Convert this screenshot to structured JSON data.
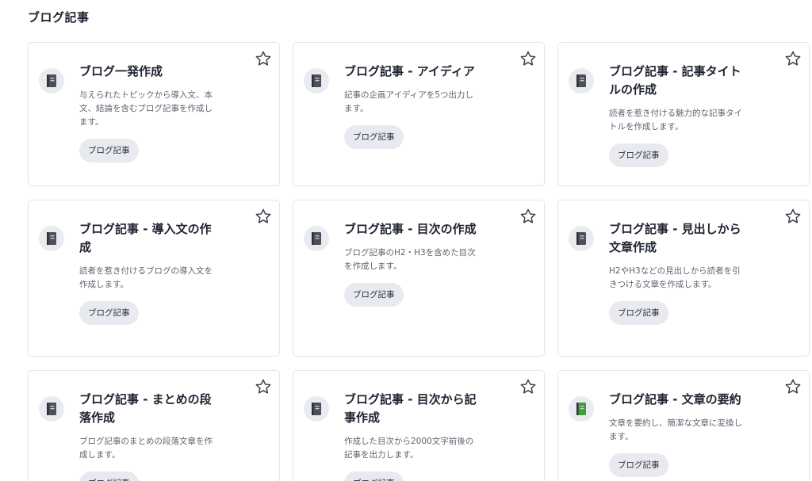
{
  "page": {
    "section_title": "ブログ記事"
  },
  "cards": [
    {
      "title": "ブログ一発作成",
      "description": "与えられたトピックから導入文、本文、結論を含むブログ記事を作成します。",
      "tag": "ブログ記事",
      "icon": "notebook-icon",
      "icon_color": "#4b4f57"
    },
    {
      "title": "ブログ記事 - アイディア",
      "description": "記事の企画アイディアを5つ出力します。",
      "tag": "ブログ記事",
      "icon": "notebook-icon",
      "icon_color": "#4b4f57"
    },
    {
      "title": "ブログ記事 - 記事タイトルの作成",
      "description": "読者を惹き付ける魅力的な記事タイトルを作成します。",
      "tag": "ブログ記事",
      "icon": "notebook-icon",
      "icon_color": "#4b4f57"
    },
    {
      "title": "ブログ記事 - 導入文の作成",
      "description": "読者を惹き付けるブログの導入文を作成します。",
      "tag": "ブログ記事",
      "icon": "notebook-icon",
      "icon_color": "#4b4f57"
    },
    {
      "title": "ブログ記事 - 目次の作成",
      "description": "ブログ記事のH2・H3を含めた目次を作成します。",
      "tag": "ブログ記事",
      "icon": "notebook-icon",
      "icon_color": "#4b4f57"
    },
    {
      "title": "ブログ記事 - 見出しから文章作成",
      "description": "H2やH3などの見出しから読者を引きつける文章を作成します。",
      "tag": "ブログ記事",
      "icon": "notebook-icon",
      "icon_color": "#4b4f57"
    },
    {
      "title": "ブログ記事 - まとめの段落作成",
      "description": "ブログ記事のまとめの段落文章を作成します。",
      "tag": "ブログ記事",
      "icon": "notebook-icon",
      "icon_color": "#4b4f57"
    },
    {
      "title": "ブログ記事 - 目次から記事作成",
      "description": "作成した目次から2000文字前後の記事を出力します。",
      "tag": "ブログ記事",
      "icon": "notebook-icon",
      "icon_color": "#4b4f57"
    },
    {
      "title": "ブログ記事 - 文章の要約",
      "description": "文章を要約し、簡潔な文章に変換します。",
      "tag": "ブログ記事",
      "icon": "green-book-icon",
      "icon_color": "#3f9a3a"
    }
  ]
}
